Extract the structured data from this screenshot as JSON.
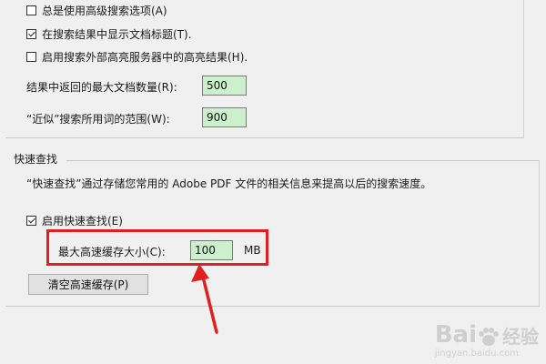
{
  "options": {
    "advanced_search_label": "总是使用高级搜索选项(A)",
    "advanced_search_checked": false,
    "show_title_label": "在搜索结果中显示文档标题(T).",
    "show_title_checked": true,
    "external_highlight_label": "启用搜索外部高亮服务器中的高亮结果(H).",
    "external_highlight_checked": false,
    "max_docs_label": "结果中返回的最大文档数量(R):",
    "max_docs_value": "500",
    "proximity_label": "“近似”搜索所用词的范围(W):",
    "proximity_value": "900"
  },
  "fast_find": {
    "group_title": "快速查找",
    "description": "“快速查找”通过存储您常用的 Adobe PDF 文件的相关信息来提高以后的搜索速度。",
    "enable_label": "启用快速查找(E)",
    "enable_checked": true,
    "cache_size_label": "最大高速缓存大小(C):",
    "cache_size_value": "100",
    "cache_unit": "MB",
    "clear_cache_label": "清空高速缓存(P)"
  },
  "annotation": {
    "highlight_color": "#e02020",
    "arrow_color": "#e02020"
  },
  "watermark": {
    "logo": "Bai",
    "logo_tail": "经验",
    "sub": "jingyan.baidu.com"
  }
}
